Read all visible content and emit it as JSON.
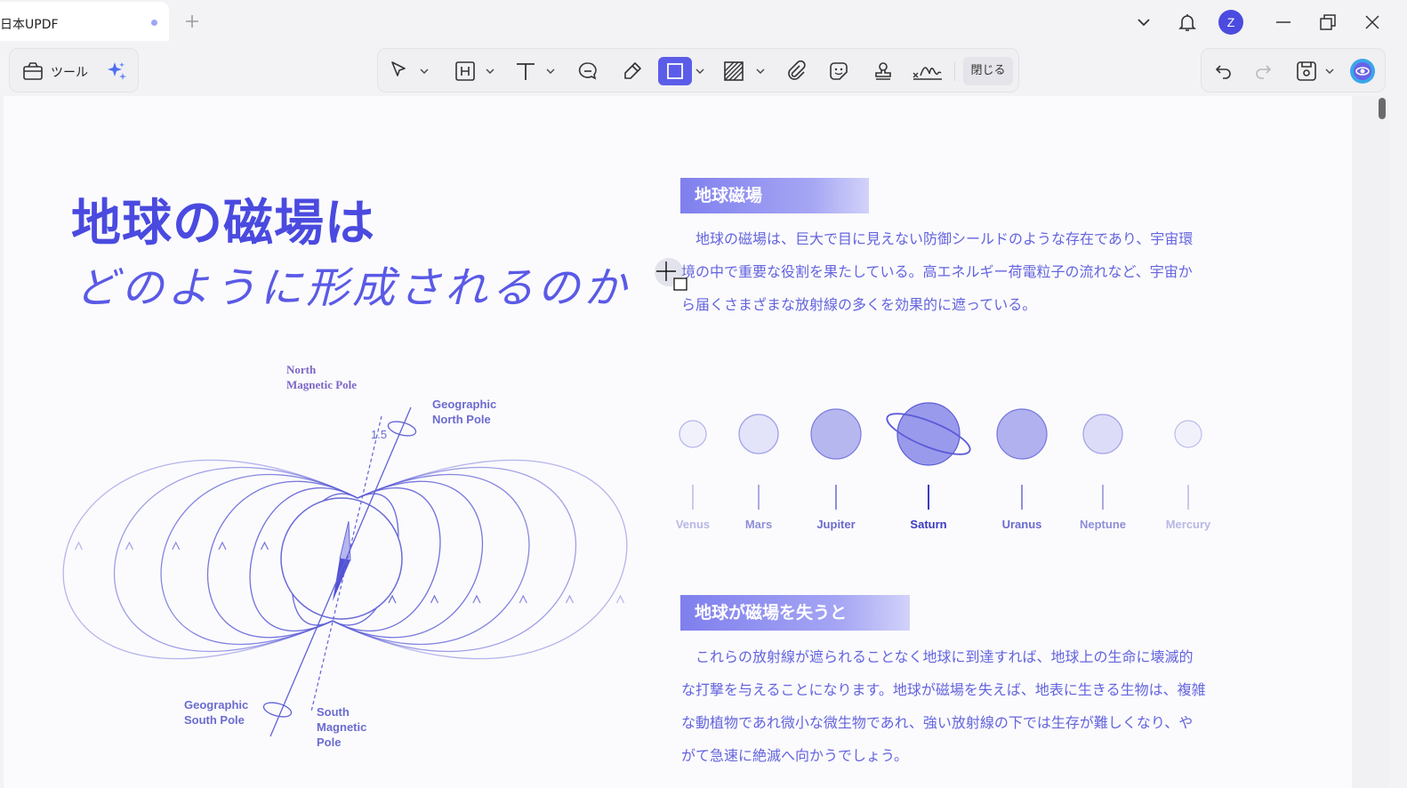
{
  "tab": {
    "title": "日本UPDF"
  },
  "user": {
    "avatar_letter": "Z"
  },
  "toolbar": {
    "tools_label": "ツール",
    "close_label": "閉じる"
  },
  "document": {
    "title_main": "地球の磁場は",
    "title_sub": "どのように形成されるのか",
    "section1": {
      "heading": "地球磁場",
      "text": "　地球の磁場は、巨大で目に見えない防御シールドのような存在であり、宇宙環境の中で重要な役割を果たしている。高エネルギー荷電粒子の流れなど、宇宙から届くさまざまな放射線の多くを効果的に遮っている。"
    },
    "section2": {
      "heading": "地球が磁場を失うと",
      "text": "　これらの放射線が遮られることなく地球に到達すれば、地球上の生命に壊滅的な打撃を与えることになります。地球が磁場を失えば、地表に生きる生物は、複雑な動植物であれ微小な微生物であれ、強い放射線の下では生存が難しくなり、やがて急速に絶滅へ向かうでしょう。"
    },
    "planets": [
      {
        "name": "Venus"
      },
      {
        "name": "Mars"
      },
      {
        "name": "Jupiter"
      },
      {
        "name": "Saturn"
      },
      {
        "name": "Uranus"
      },
      {
        "name": "Neptune"
      },
      {
        "name": "Mercury"
      }
    ],
    "magnetic": {
      "north_magnetic_pole": [
        "North",
        "Magnetic Pole"
      ],
      "geographic_north_pole": [
        "Geographic",
        "North Pole"
      ],
      "geographic_south_pole": [
        "Geographic",
        "South Pole"
      ],
      "south_magnetic_pole": [
        "South",
        "Magnetic",
        "Pole"
      ],
      "angle": "1.5"
    }
  },
  "colors": {
    "accent": "#5b5de8",
    "title": "#4a4ae0",
    "text": "#6464de"
  }
}
